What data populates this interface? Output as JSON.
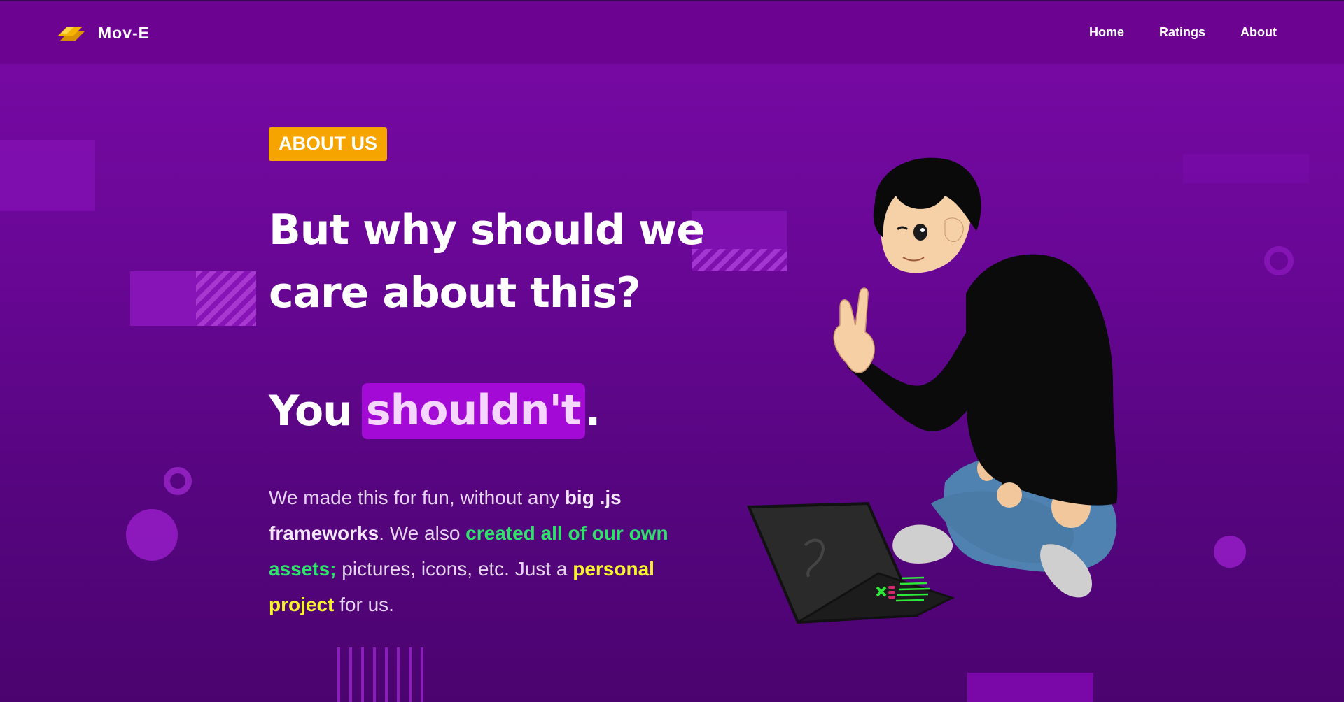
{
  "nav": {
    "brand": "Mov-E",
    "links": [
      {
        "label": "Home"
      },
      {
        "label": "Ratings"
      },
      {
        "label": "About"
      }
    ]
  },
  "hero": {
    "tag": "ABOUT US",
    "headline_line1": "But why should we",
    "headline_line2": "care about this?",
    "punch_prefix": "You",
    "punch_highlight": "shouldn't",
    "punch_suffix": ".",
    "body": {
      "p1": "We made this for fun, without any ",
      "b1": "big .js",
      "b2": "frameworks",
      "p2": ". We also ",
      "g1": "created all of our own",
      "g2": "assets;",
      "p3": " pictures, icons, etc. Just a ",
      "y1": "personal",
      "y2": "project",
      "p4": " for us."
    }
  },
  "colors": {
    "accent_tag": "#f6a400",
    "highlight_bg": "#a40ad6",
    "green_text": "#2fe36a",
    "yellow_text": "#f6f22e",
    "background": "#6a0797"
  },
  "icons": {
    "logo": "ticket-logo-icon",
    "illustration": "boy-with-laptop-illustration"
  }
}
